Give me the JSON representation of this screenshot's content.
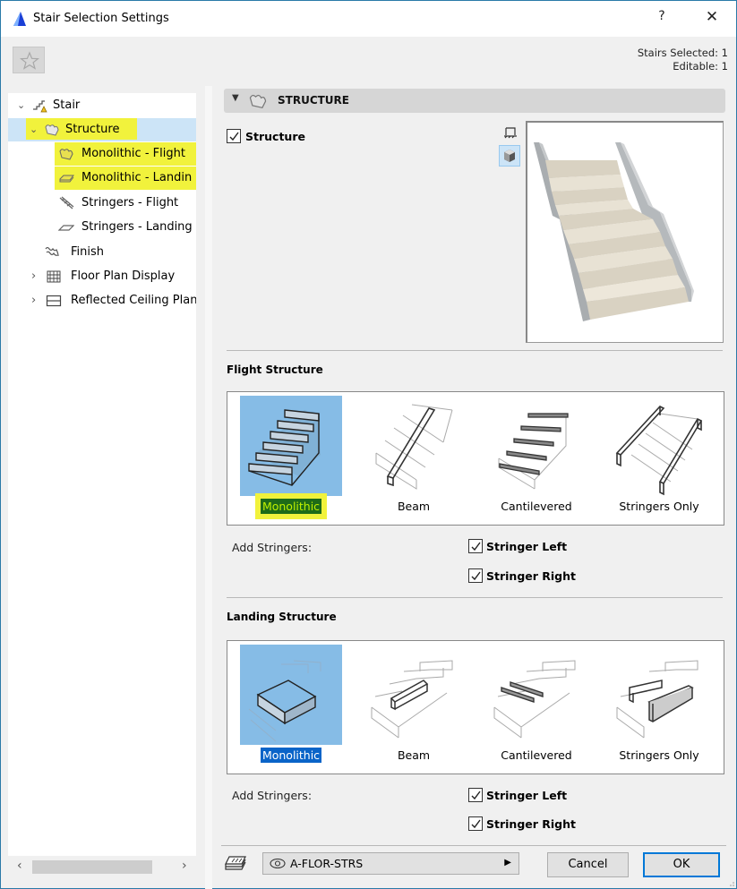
{
  "window": {
    "title": "Stair Selection Settings",
    "help_label": "?",
    "close_label": "✕"
  },
  "header": {
    "favorites_icon": "star-icon",
    "selection_info": {
      "selected": "Stairs Selected: 1",
      "editable": "Editable: 1"
    }
  },
  "tree": {
    "items": [
      {
        "label": "Stair",
        "icon": "stair-icon",
        "expanded": true
      },
      {
        "label": "Structure",
        "icon": "structure-icon",
        "expanded": true,
        "selected": true,
        "highlighted": true
      },
      {
        "label": "Monolithic - Flight",
        "icon": "monolithic-flight-icon",
        "highlighted": true
      },
      {
        "label": "Monolithic - Landin",
        "icon": "monolithic-landing-icon",
        "highlighted": true
      },
      {
        "label": "Stringers - Flight",
        "icon": "stringers-flight-icon"
      },
      {
        "label": "Stringers - Landing",
        "icon": "stringers-landing-icon"
      },
      {
        "label": "Finish",
        "icon": "finish-icon"
      },
      {
        "label": "Floor Plan Display",
        "icon": "floor-plan-icon",
        "expanded": false
      },
      {
        "label": "Reflected Ceiling Plan",
        "icon": "ceiling-plan-icon",
        "expanded": false
      }
    ],
    "scroll_left": "‹",
    "scroll_right": "›"
  },
  "panel": {
    "section_title": "STRUCTURE",
    "structure_checkbox": {
      "label": "Structure",
      "checked": true
    },
    "view_buttons": [
      "plan-view",
      "3d-view"
    ],
    "active_view": "3d-view"
  },
  "flight": {
    "title": "Flight Structure",
    "options": [
      "Monolithic",
      "Beam",
      "Cantilevered",
      "Stringers Only"
    ],
    "selected": "Monolithic",
    "add_stringers_label": "Add Stringers:",
    "stringer_left": {
      "label": "Stringer Left",
      "checked": true
    },
    "stringer_right": {
      "label": "Stringer Right",
      "checked": true
    }
  },
  "landing": {
    "title": "Landing Structure",
    "options": [
      "Monolithic",
      "Beam",
      "Cantilevered",
      "Stringers Only"
    ],
    "selected": "Monolithic",
    "add_stringers_label": "Add Stringers:",
    "stringer_left": {
      "label": "Stringer Left",
      "checked": true
    },
    "stringer_right": {
      "label": "Stringer Right",
      "checked": true
    }
  },
  "footer": {
    "layer": "A-FLOR-STRS",
    "cancel_label": "Cancel",
    "ok_label": "OK"
  },
  "colors": {
    "selection_blue": "#86bce6",
    "tree_selected": "#cce4f7",
    "highlight_yellow": "#f1f23c",
    "accent": "#0078d7"
  }
}
